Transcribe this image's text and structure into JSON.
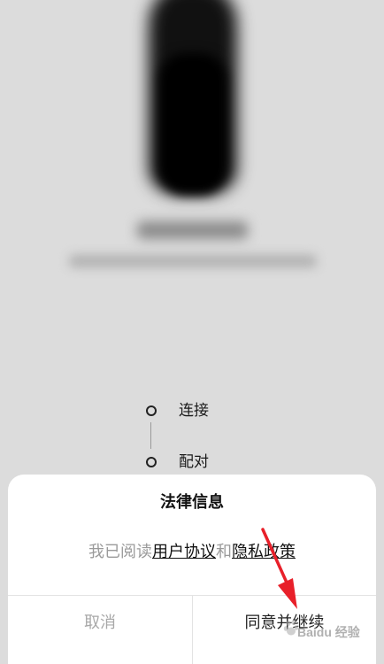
{
  "steps": [
    {
      "label": "连接"
    },
    {
      "label": "配对"
    }
  ],
  "dialog": {
    "title": "法律信息",
    "body_prefix": "我已阅读",
    "user_agreement_link": "用户协议",
    "conjunction": "和",
    "privacy_policy_link": "隐私政策",
    "cancel_label": "取消",
    "agree_label": "同意并继续"
  },
  "watermark": {
    "text": "Baidu 经验"
  },
  "colors": {
    "background": "#dcdcdc",
    "dialog_bg": "#ffffff",
    "annotation_arrow": "#e8202a",
    "muted_text": "#9a9a9a",
    "link_text": "#111111"
  }
}
